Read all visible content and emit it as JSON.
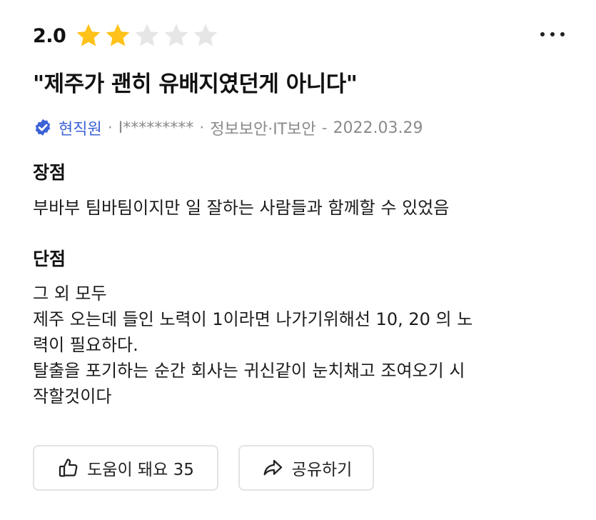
{
  "review": {
    "rating": "2.0",
    "rating_value": 2,
    "rating_max": 5,
    "title": "\"제주가 괜히 유배지였던게 아니다\"",
    "author": {
      "status": "현직원",
      "id": "I*********",
      "department": "정보보안·IT보안",
      "date": "2022.03.29",
      "sep1": "·",
      "sep2": "·",
      "sep3": "-"
    },
    "pros": {
      "heading": "장점",
      "lines": [
        "부바부 팀바팀이지만 일 잘하는 사람들과 함께할 수 있었음"
      ]
    },
    "cons": {
      "heading": "단점",
      "lines": [
        "그 외 모두",
        "제주 오는데 들인 노력이 1이라면 나가기위해선 10, 20 의 노",
        "력이 필요하다.",
        "탈출을 포기하는 순간 회사는 귀신같이 눈치채고 조여오기 시",
        "작할것이다"
      ]
    }
  },
  "actions": {
    "helpful_label": "도움이 돼요 35",
    "share_label": "공유하기"
  },
  "icons": {
    "more": "more-horizontal-icon",
    "star": "star-icon",
    "verified": "verified-badge-icon",
    "thumbs_up": "thumbs-up-icon",
    "share": "share-arrow-icon"
  },
  "colors": {
    "star_filled": "#ffc21a",
    "star_empty": "#e6e6e6",
    "verified": "#3b62d6",
    "meta_gray": "#8a8a8a",
    "button_border": "#e3e3e3"
  }
}
